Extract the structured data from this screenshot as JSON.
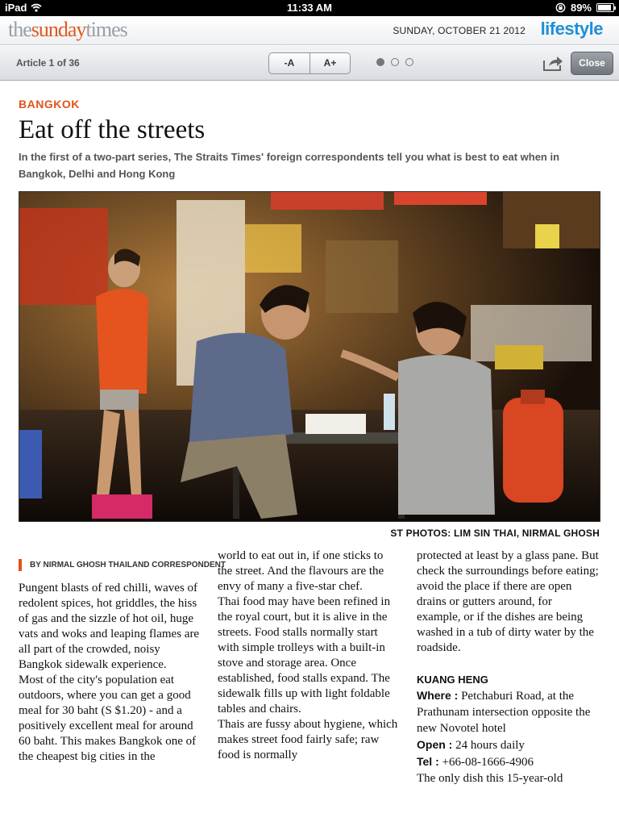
{
  "status_bar": {
    "device": "iPad",
    "time": "11:33 AM",
    "battery": "89%",
    "battery_level": 0.89
  },
  "masthead": {
    "logo": {
      "part1": "the",
      "part2": "sunday",
      "part3": "times"
    },
    "date": "SUNDAY, OCTOBER 21 2012",
    "section": "lifestyle"
  },
  "toolbar": {
    "article_count": "Article 1 of 36",
    "font_smaller": "-A",
    "font_larger": "A+",
    "pages": 3,
    "current_page": 1,
    "close_label": "Close"
  },
  "article": {
    "kicker": "BANGKOK",
    "headline": "Eat off the streets",
    "standfirst": "In the first of a two-part series, The Straits Times' foreign correspondents tell you what is best to eat when in Bangkok, Delhi and Hong Kong",
    "photo_caption": "ST PHOTOS: LIM SIN THAI, NIRMAL GHOSH",
    "byline": "BY NIRMAL GHOSH THAILAND CORRESPONDENT",
    "col1": [
      "Pungent blasts of red chilli, waves of redolent spices, hot griddles, the hiss of gas and the sizzle of hot oil, huge vats and woks and leaping flames are all part of the crowded, noisy Bangkok sidewalk experience.",
      " Most of the city's population eat outdoors, where you can get a good meal for 30 baht (S $1.20) - and a positively excellent meal for around 60 baht. This makes Bangkok one of the cheapest big cities in the"
    ],
    "col2": [
      "world to eat out in, if one sticks to the street. And the flavours are the envy of many a five-star chef.",
      " Thai food may have been refined in the royal court, but it is alive in the streets. Food stalls normally start with simple trolleys with a built-in stove and storage area. Once established, food stalls expand. The sidewalk fills up with light foldable tables and chairs.",
      " Thais are fussy about hygiene, which makes street food fairly safe; raw food is normally"
    ],
    "col3": [
      "protected at least by a glass pane. But check the surroundings before eating; avoid the place if there are open drains or gutters around, for example, or if the dishes are being washed in a tub of dirty water by the roadside."
    ],
    "info": {
      "name": "KUANG HENG",
      "where_label": "Where :",
      "where_value": " Petchaburi Road, at the Prathunam intersection opposite the new Novotel hotel",
      "open_label": "Open :",
      "open_value": " 24 hours daily",
      "tel_label": "Tel :",
      "tel_value": " +66-08-1666-4906",
      "tail": " The only dish this 15-year-old"
    }
  }
}
